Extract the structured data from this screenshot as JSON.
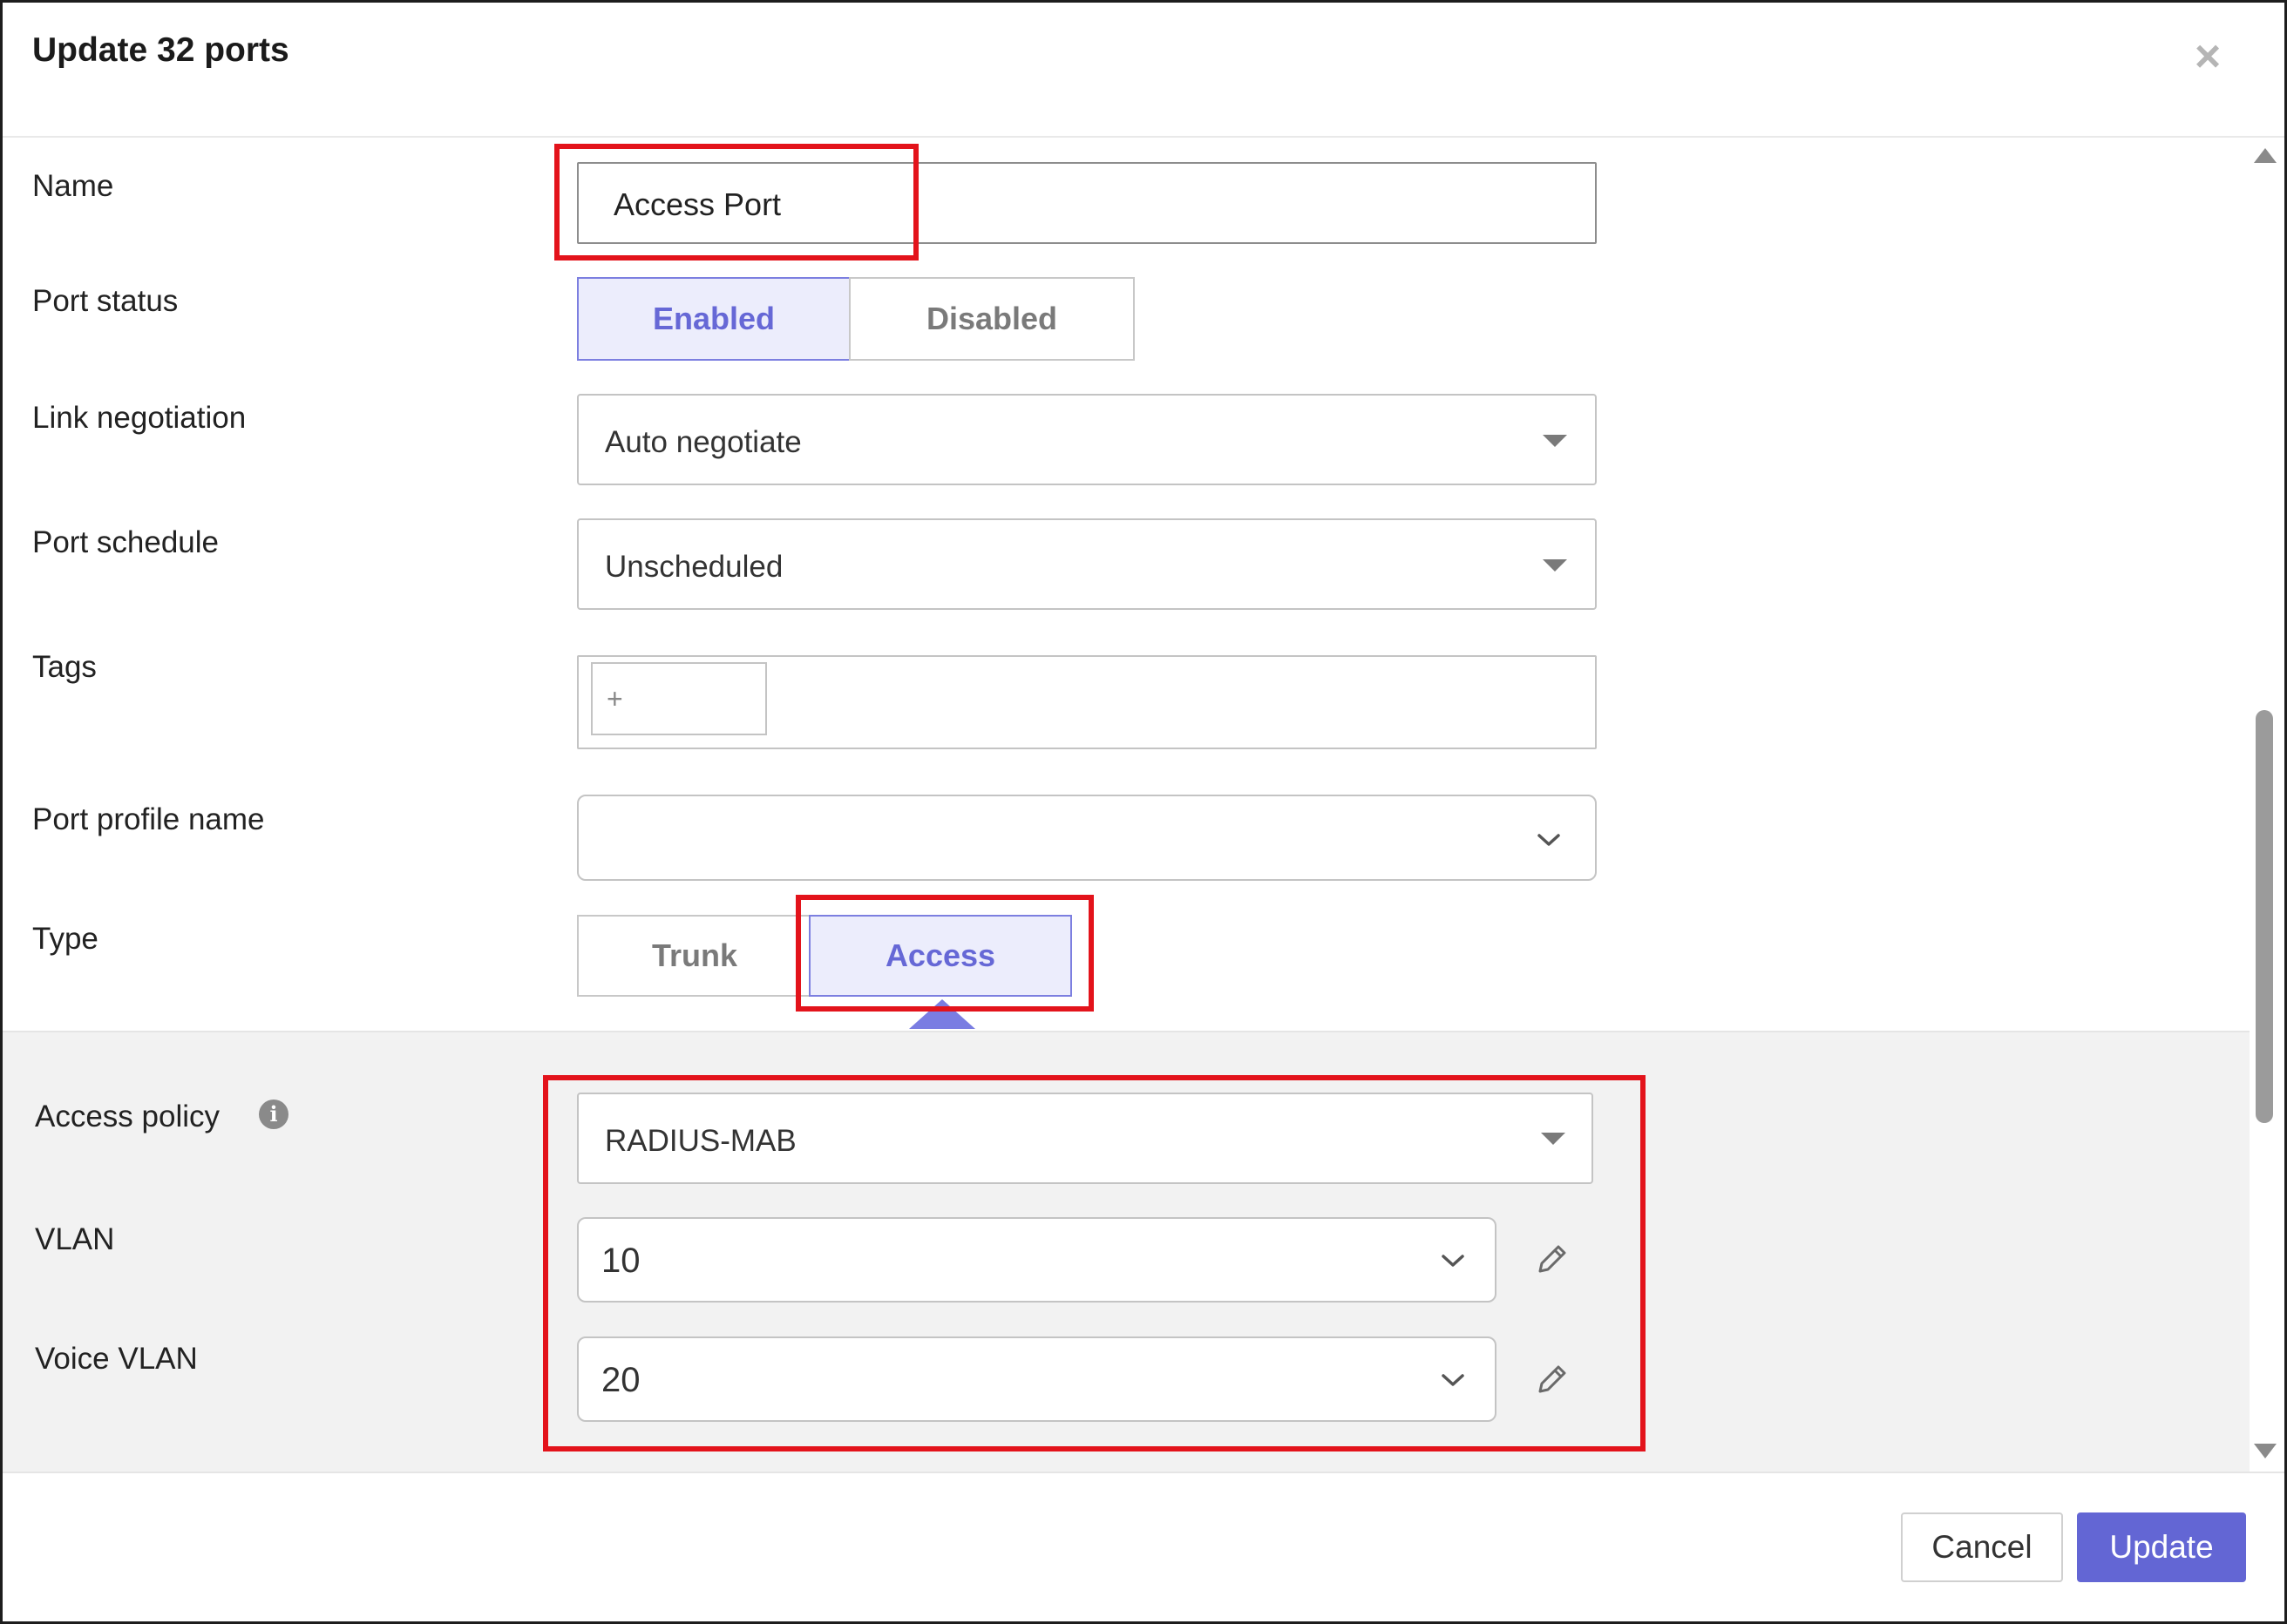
{
  "dialog": {
    "title": "Update 32 ports",
    "close_symbol": "×"
  },
  "fields": {
    "name": {
      "label": "Name",
      "value": "Access Port"
    },
    "port_status": {
      "label": "Port status",
      "options": [
        "Enabled",
        "Disabled"
      ],
      "selected": "Enabled"
    },
    "link_negotiation": {
      "label": "Link negotiation",
      "value": "Auto negotiate"
    },
    "port_schedule": {
      "label": "Port schedule",
      "value": "Unscheduled"
    },
    "tags": {
      "label": "Tags",
      "add_symbol": "+"
    },
    "port_profile_name": {
      "label": "Port profile name",
      "value": ""
    },
    "type": {
      "label": "Type",
      "options": [
        "Trunk",
        "Access"
      ],
      "selected": "Access"
    },
    "access_policy": {
      "label": "Access policy",
      "value": "RADIUS-MAB",
      "info_symbol": "i"
    },
    "vlan": {
      "label": "VLAN",
      "value": "10"
    },
    "voice_vlan": {
      "label": "Voice VLAN",
      "value": "20"
    }
  },
  "footer": {
    "cancel_label": "Cancel",
    "update_label": "Update"
  },
  "icons": {
    "close": "close-icon",
    "dropdown": "caret-down-icon",
    "chevron": "chevron-down-icon",
    "info": "info-icon",
    "edit": "pencil-icon",
    "scroll_up": "scroll-up-icon",
    "scroll_down": "scroll-down-icon"
  },
  "colors": {
    "accent": "#6366d4",
    "active_segment_bg": "#ecedfc",
    "highlight": "#e3131b",
    "panel_bg": "#f2f2f2"
  }
}
